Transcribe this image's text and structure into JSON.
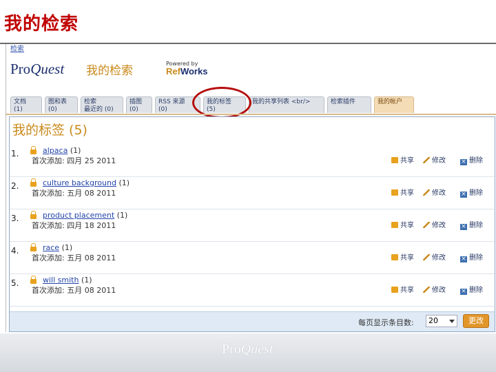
{
  "slide": {
    "title": "我的检索"
  },
  "app": {
    "breadcrumb": "检索",
    "logo_text_a": "Pro",
    "logo_text_b": "Quest",
    "title": "我的检索",
    "powered_by": "Powered by",
    "refworks_a": "Ref",
    "refworks_b": "Works"
  },
  "tabs": [
    {
      "line1": "文档",
      "line2": "(1)"
    },
    {
      "line1": "图和表",
      "line2": "(0)"
    },
    {
      "line1": "检索",
      "line2": "最近的 (0)"
    },
    {
      "line1": "插图",
      "line2": "(0)"
    },
    {
      "line1": "RSS 来源",
      "line2": "(0)"
    },
    {
      "line1": "我的标签",
      "line2": "(5)"
    },
    {
      "line1": "我的共享列表 <br/>",
      "line2": ""
    },
    {
      "line1": "检索插件",
      "line2": ""
    },
    {
      "line1": "我的帐户",
      "line2": ""
    }
  ],
  "panel": {
    "title": "我的标签 (5)"
  },
  "tags": [
    {
      "num": "1.",
      "name": "alpaca",
      "count": "(1)",
      "added": "首次添加: 四月 25 2011"
    },
    {
      "num": "2.",
      "name": "culture background",
      "count": "(1)",
      "added": "首次添加: 五月 08 2011"
    },
    {
      "num": "3.",
      "name": "product placement",
      "count": "(1)",
      "added": "首次添加: 四月 18 2011"
    },
    {
      "num": "4.",
      "name": "race",
      "count": "(1)",
      "added": "首次添加: 五月 08 2011"
    },
    {
      "num": "5.",
      "name": "will smith",
      "count": "(1)",
      "added": "首次添加: 五月 08 2011"
    }
  ],
  "actions": {
    "share": "共享",
    "edit": "修改",
    "delete": "删除"
  },
  "footer": {
    "per_page_label": "每页显示条目数:",
    "per_page_value": "20",
    "change_button": "更改"
  },
  "bottom": {
    "logo_a": "Pro",
    "logo_b": "Quest"
  }
}
